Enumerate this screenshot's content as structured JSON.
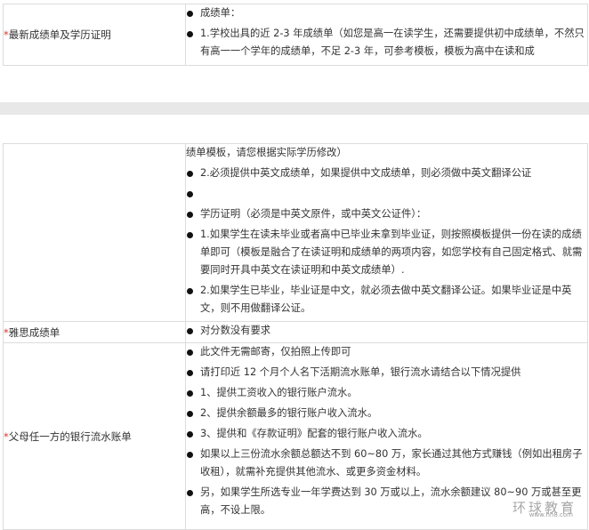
{
  "table_top": {
    "row_transcript": {
      "star": "*",
      "label": "最新成绩单及学历证明",
      "items": [
        {
          "type": "bullet",
          "text": "成绩单："
        },
        {
          "type": "bullet",
          "text": "1.学校出具的近 2-3 年成绩单（如您是高一在读学生，还需要提供初中成绩单，不然只有高一一个学年的成绩单，不足 2-3 年，可参考模板，模板为高中在读和成"
        }
      ]
    }
  },
  "table_bottom": {
    "row_transcript_cont": {
      "items": [
        {
          "type": "plain",
          "text": "绩单模板，请您根据实际学历修改）"
        },
        {
          "type": "bullet",
          "text": "2.必须提供中英文成绩单，如果提供中文成绩单，则必须做中英文翻译公证"
        },
        {
          "type": "bullet",
          "text": ""
        },
        {
          "type": "bullet",
          "text": "学历证明（必须是中英文原件，或中英文公证件）："
        },
        {
          "type": "bullet",
          "text": "1.如果学生在读未毕业或者高中已毕业未拿到毕业证，则按照模板提供一份在读的成绩单即可（模板是融合了在读证明和成绩单的两项内容，如您学校有自己固定格式、就需要同时开具中英文在读证明和中英文成绩单）."
        },
        {
          "type": "bullet",
          "text": "2.如果学生已毕业，毕业证是中文，就必须去做中英文翻译公证。如果毕业证是中英文，则不用做翻译公证。"
        }
      ]
    },
    "row_ielts": {
      "star": "*",
      "label": "雅思成绩单",
      "items": [
        {
          "type": "bullet",
          "text": "对分数没有要求"
        }
      ]
    },
    "row_bank": {
      "star": "*",
      "label": "父母任一方的银行流水账单",
      "items": [
        {
          "type": "bullet",
          "text": "此文件无需邮寄，仅拍照上传即可"
        },
        {
          "type": "bullet",
          "text": "请打印近 12 个月个人名下活期流水账单，银行流水请结合以下情况提供"
        },
        {
          "type": "bullet",
          "text": "1、提供工资收入的银行账户流水。"
        },
        {
          "type": "bullet",
          "text": "2、提供余额最多的银行账户收入流水。"
        },
        {
          "type": "bullet",
          "text": "3、提供和《存款证明》配套的银行账户收入流水。"
        },
        {
          "type": "bullet",
          "text": "如果以上三份流水余额总额达不到 60~80 万，家长通过其他方式赚钱（例如出租房子收租），就需补充提供其他流水、或更多资金材料。"
        },
        {
          "type": "bullet",
          "text": "另，如果学生所选专业一年学费达到 30 万或以上，流水余额建议 80~90 万或甚至更高，不设上限。"
        }
      ]
    }
  },
  "watermark": {
    "text": "环球教育",
    "sub": "www.hh8.com"
  }
}
